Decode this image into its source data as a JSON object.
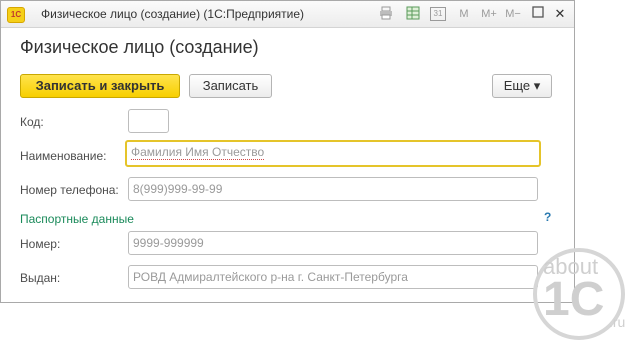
{
  "window": {
    "app_logo": "1С",
    "title": "Физическое лицо (создание)  (1С:Предприятие)",
    "toolbar_icons": [
      "printer-icon",
      "table-icon",
      "calendar-icon",
      "memory-icon",
      "memory-plus-icon",
      "memory-minus-icon",
      "minimize-icon",
      "maximize-icon",
      "close-icon"
    ],
    "icon_labels": {
      "calendar": "31",
      "m": "M",
      "mplus": "M+",
      "mminus": "M−",
      "close": "✕"
    }
  },
  "form": {
    "heading": "Физическое лицо (создание)",
    "buttons": {
      "save_close": "Записать и закрыть",
      "save": "Записать",
      "more": "Еще ▾"
    },
    "fields": {
      "code_label": "Код:",
      "code_value": "",
      "name_label": "Наименование:",
      "name_placeholder": "Фамилия Имя Отчество",
      "phone_label": "Номер телефона:",
      "phone_placeholder": "8(999)999-99-99",
      "section_title": "Паспортные данные",
      "help": "?",
      "number_label": "Номер:",
      "number_placeholder": "9999-999999",
      "issued_label": "Выдан:",
      "issued_placeholder": "РОВД Адмиралтейского р-на г. Санкт-Петербурга"
    }
  },
  "watermark": {
    "line1": "about",
    "line2": "1C",
    "line3": ".ru"
  },
  "colors": {
    "primary_button": "#f7cf00",
    "focus_border": "#e5c42a",
    "section_title": "#1a8a5a",
    "help": "#2a7ab0"
  }
}
